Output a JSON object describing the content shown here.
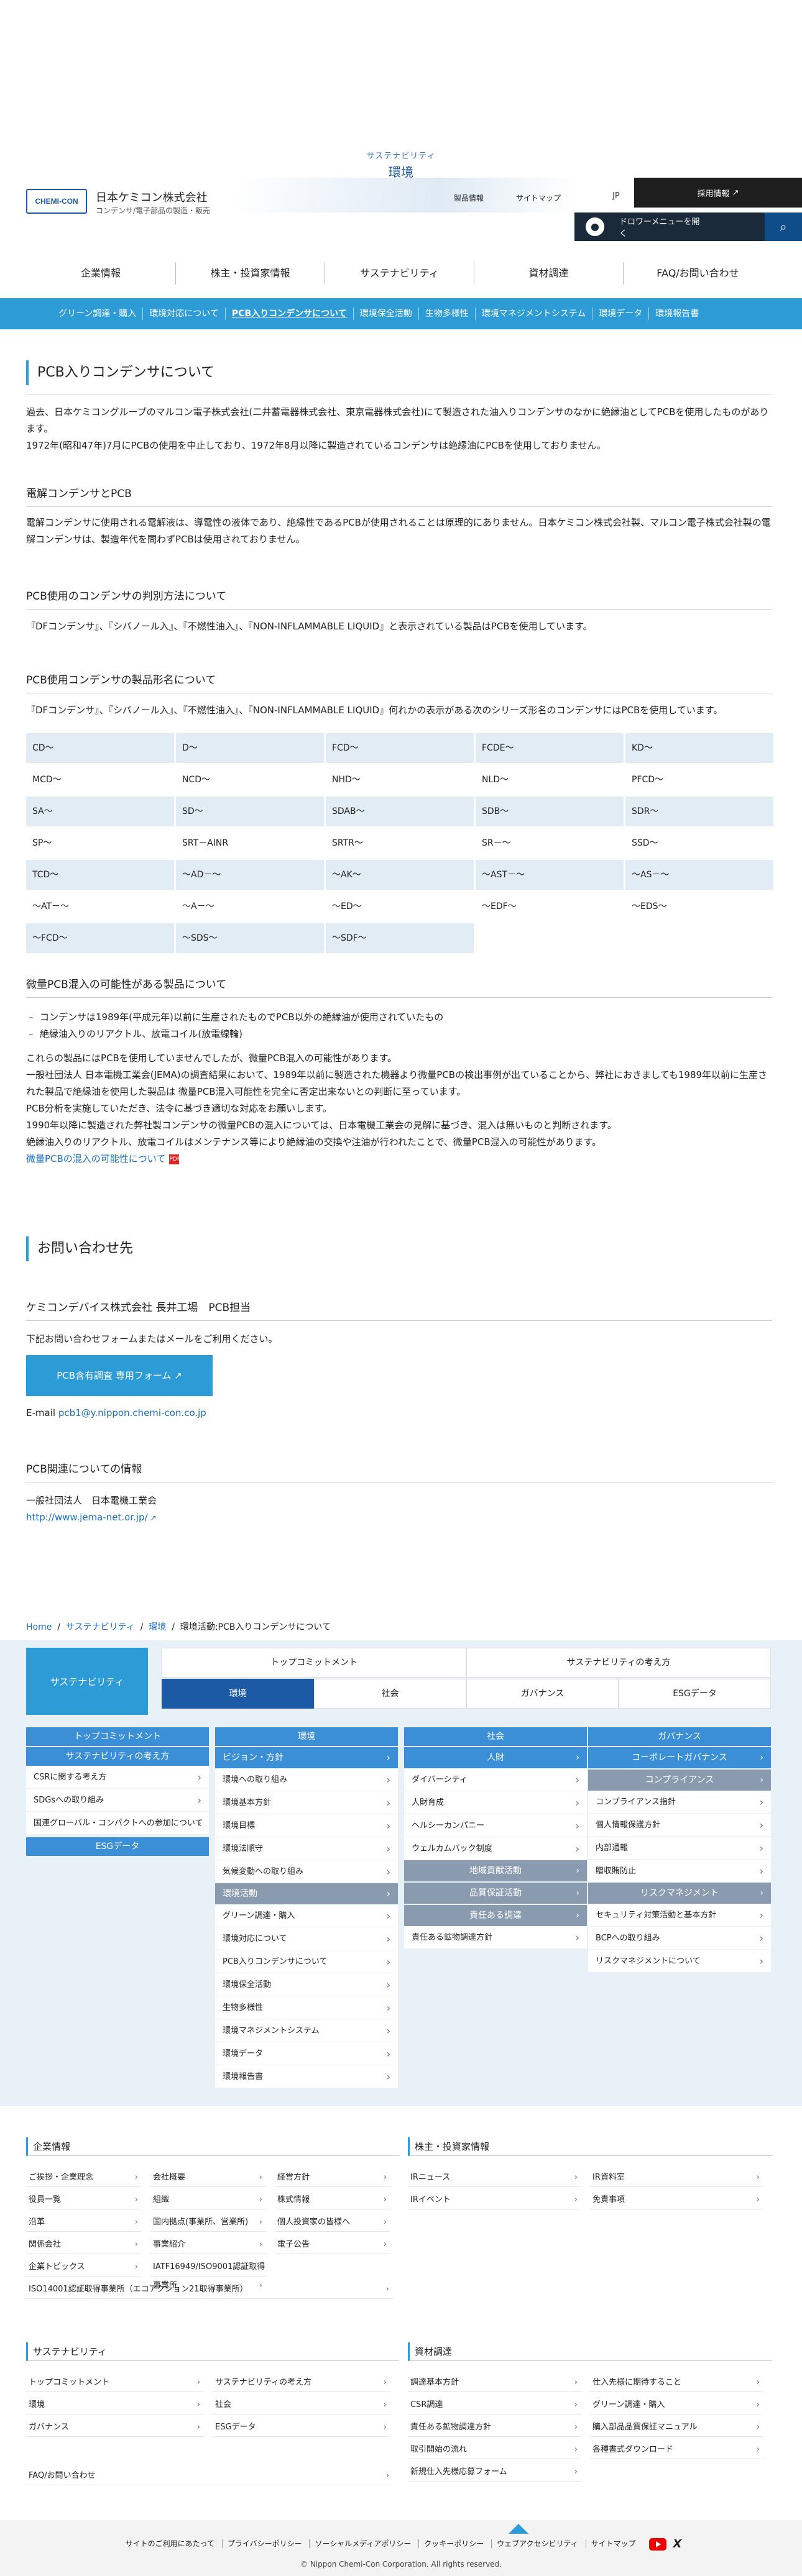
{
  "header": {
    "category": "サステナビリティ",
    "page_title": "環境",
    "logo_text": "CHEMI-CON",
    "company_name": "日本ケミコン株式会社",
    "company_sub": "コンデンサ/電子部品の製造・販売",
    "links": [
      "製品情報",
      "サイトマップ"
    ],
    "lang": "JP",
    "recruit": "採用情報",
    "dropdown": "ドロワーメニューを開く"
  },
  "nav": [
    "企業情報",
    "株主・投資家情報",
    "サステナビリティ",
    "資材調達",
    "FAQ/お問い合わせ"
  ],
  "subnav": [
    "グリーン調達・購入",
    "環境対応について",
    "PCB入りコンデンサについて",
    "環境保全活動",
    "生物多様性",
    "環境マネジメントシステム",
    "環境データ",
    "環境報告書"
  ],
  "main": {
    "title": "PCB入りコンデンサについて",
    "intro1": "過去、日本ケミコングループのマルコン電子株式会社(二井蓄電器株式会社、東京電器株式会社)にて製造された油入りコンデンサのなかに絶縁油としてPCBを使用したものがあります。",
    "intro2": "1972年(昭和47年)7月にPCBの使用を中止しており、1972年8月以降に製造されているコンデンサは絶縁油にPCBを使用しておりません。",
    "s1_title": "電解コンデンサとPCB",
    "s1_text": "電解コンデンサに使用される電解液は、導電性の液体であり、絶縁性であるPCBが使用されることは原理的にありません。日本ケミコン株式会社製、マルコン電子株式会社製の電解コンデンサは、製造年代を問わずPCBは使用されておりません。",
    "s2_title": "PCB使用のコンデンサの判別方法について",
    "s2_text": "『DFコンデンサ』、『シバノール入』、『不燃性油入』、『NON-INFLAMMABLE LIQUID』と表示されている製品はPCBを使用しています。",
    "s3_title": "PCB使用コンデンサの製品形名について",
    "s3_text": "『DFコンデンサ』、『シバノール入』、『不燃性油入』、『NON-INFLAMMABLE LIQUID』何れかの表示がある次のシリーズ形名のコンデンサにはPCBを使用しています。",
    "grid": [
      "CD〜",
      "D〜",
      "FCD〜",
      "FCDE〜",
      "KD〜",
      "MCD〜",
      "NCD〜",
      "NHD〜",
      "NLD〜",
      "PFCD〜",
      "SA〜",
      "SD〜",
      "SDAB〜",
      "SDB〜",
      "SDR〜",
      "SP〜",
      "SRT－AINR",
      "SRTR〜",
      "SR－〜",
      "SSD〜",
      "TCD〜",
      "〜AD－〜",
      "〜AK〜",
      "〜AST－〜",
      "〜AS－〜",
      "〜AT－〜",
      "〜A－〜",
      "〜ED〜",
      "〜EDF〜",
      "〜EDS〜",
      "〜FCD〜",
      "〜SDS〜",
      "〜SDF〜"
    ],
    "s4_title": "微量PCB混入の可能性がある製品について",
    "s4_bul1": "コンデンサは1989年(平成元年)以前に生産されたものでPCB以外の絶縁油が使用されていたもの",
    "s4_bul2": "絶縁油入りのリアクトル、放電コイル(放電線輪)",
    "s4_p1": "これらの製品にはPCBを使用していませんでしたが、微量PCB混入の可能性があります。",
    "s4_p2": "一般社団法人 日本電機工業会(JEMA)の調査結果において、1989年以前に製造された機器より微量PCBの検出事例が出ていることから、弊社におきましても1989年以前に生産された製品で絶縁油を使用した製品は 微量PCB混入可能性を完全に否定出来ないとの判断に至っています。",
    "s4_p3": "PCB分析を実施していただき、法令に基づき適切な対応をお願いします。",
    "s4_p4": "1990年以降に製造された弊社製コンデンサの微量PCBの混入については、日本電機工業会の見解に基づき、混入は無いものと判断されます。",
    "s4_p5": "絶縁油入りのリアクトル、放電コイルはメンテナンス等により絶縁油の交換や注油が行われたことで、微量PCB混入の可能性があります。",
    "s4_link": "微量PCBの混入の可能性について",
    "contact_title": "お問い合わせ先",
    "contact_org": "ケミコンデバイス株式会社 長井工場　PCB担当",
    "contact_text": "下記お問い合わせフォームまたはメールをご利用ください。",
    "form_btn": "PCB含有調査 専用フォーム",
    "email_label": "E-mail",
    "email": "pcb1@y.nippon.chemi-con.co.jp",
    "rel_title": "PCB関連についての情報",
    "rel_org": "一般社団法人　日本電機工業会",
    "rel_url": "http://www.jema-net.or.jp/"
  },
  "breadcrumb": [
    "Home",
    "サステナビリティ",
    "環境",
    "環境活動:PCB入りコンデンサについて"
  ],
  "sitemap": {
    "box": "サステナビリティ",
    "top_tabs": [
      "トップコミットメント",
      "サステナビリティの考え方"
    ],
    "tabs": [
      "環境",
      "社会",
      "ガバナンス",
      "ESGデータ"
    ],
    "col1": {
      "head1": "トップコミットメント",
      "head2": "サステナビリティの考え方",
      "items": [
        "CSRに関する考え方",
        "SDGsへの取り組み",
        "国連グローバル・コンパクトへの参加について"
      ],
      "head3": "ESGデータ"
    },
    "col2": {
      "head": "環境",
      "sub1": "ビジョン・方針",
      "items1": [
        "環境への取り組み",
        "環境基本方針",
        "環境目標",
        "環境法順守",
        "気候変動への取り組み"
      ],
      "sub2": "環境活動",
      "items2": [
        "グリーン調達・購入",
        "環境対応について",
        "PCB入りコンデンサについて",
        "環境保全活動",
        "生物多様性",
        "環境マネジメントシステム",
        "環境データ",
        "環境報告書"
      ]
    },
    "col3": {
      "head": "社会",
      "sub1": "人財",
      "items1": [
        "ダイバーシティ",
        "人財育成",
        "ヘルシーカンパニー",
        "ウェルカムバック制度"
      ],
      "sub2": "地域貢献活動",
      "sub3": "品質保証活動",
      "sub4": "責任ある調達",
      "items4": [
        "責任ある鉱物調達方針"
      ]
    },
    "col4": {
      "head": "ガバナンス",
      "sub1": "コーポレートガバナンス",
      "sub2": "コンプライアンス",
      "items2": [
        "コンプライアンス指針",
        "個人情報保護方針",
        "内部通報",
        "贈収賄防止"
      ],
      "sub3": "リスクマネジメント",
      "items3": [
        "セキュリティ対策活動と基本方針",
        "BCPへの取り組み",
        "リスクマネジメントについて"
      ]
    }
  },
  "footer": {
    "corp_title": "企業情報",
    "corp_links": [
      "ご挨拶・企業理念",
      "会社概要",
      "経営方針",
      "役員一覧",
      "組織",
      "株式情報",
      "沿革",
      "国内拠点(事業所、営業所)",
      "個人投資家の皆様へ",
      "関係会社",
      "事業紹介",
      "電子公告",
      "企業トピックス",
      "IATF16949/ISO9001認証取得事業所",
      "ISO14001認証取得事業所（エコアクション21取得事業所）"
    ],
    "ir_title": "株主・投資家情報",
    "ir_links": [
      "IRニュース",
      "IR資料室",
      "IRイベント",
      "免責事項"
    ],
    "sus_title": "サステナビリティ",
    "sus_links": [
      "トップコミットメント",
      "サステナビリティの考え方",
      "環境",
      "社会",
      "ガバナンス",
      "ESGデータ"
    ],
    "proc_title": "資材調達",
    "proc_links": [
      "調達基本方針",
      "仕入先様に期待すること",
      "CSR調達",
      "グリーン調達・購入",
      "責任ある鉱物調達方針",
      "購入部品品質保証マニュアル",
      "取引開始の流れ",
      "各種書式ダウンロード",
      "新規仕入先様応募フォーム"
    ],
    "faq": "FAQ/お問い合わせ",
    "bottom_links": [
      "サイトのご利用にあたって",
      "プライバシーポリシー",
      "ソーシャルメディアポリシー",
      "クッキーポリシー",
      "ウェブアクセシビリティ",
      "サイトマップ"
    ],
    "copyright": "© Nippon Chemi-Con Corporation. All rights reserved."
  }
}
